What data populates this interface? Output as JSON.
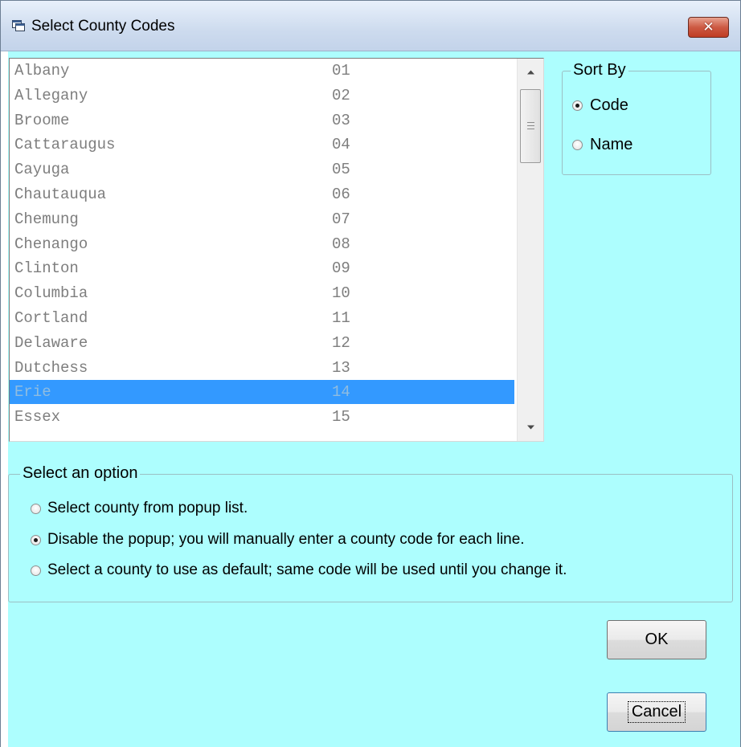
{
  "window": {
    "title": "Select County Codes",
    "close_glyph": "✕",
    "app_icon": "dialog-window-icon"
  },
  "colors": {
    "client_background": "#ADFEFE",
    "selection_highlight": "#3399FF",
    "title_bar": "#CDDBEE",
    "close_button": "#C9523B"
  },
  "county_list": {
    "selected_index": 13,
    "items": [
      {
        "name": "Albany",
        "code": "01"
      },
      {
        "name": "Allegany",
        "code": "02"
      },
      {
        "name": "Broome",
        "code": "03"
      },
      {
        "name": "Cattaraugus",
        "code": "04"
      },
      {
        "name": "Cayuga",
        "code": "05"
      },
      {
        "name": "Chautauqua",
        "code": "06"
      },
      {
        "name": "Chemung",
        "code": "07"
      },
      {
        "name": "Chenango",
        "code": "08"
      },
      {
        "name": "Clinton",
        "code": "09"
      },
      {
        "name": "Columbia",
        "code": "10"
      },
      {
        "name": "Cortland",
        "code": "11"
      },
      {
        "name": "Delaware",
        "code": "12"
      },
      {
        "name": "Dutchess",
        "code": "13"
      },
      {
        "name": "Erie",
        "code": "14"
      },
      {
        "name": "Essex",
        "code": "15"
      }
    ]
  },
  "sort_by": {
    "title": "Sort By",
    "options": [
      {
        "label": "Code",
        "checked": true
      },
      {
        "label": "Name",
        "checked": false
      }
    ]
  },
  "select_option": {
    "title": "Select an option",
    "options": [
      {
        "label": "Select county from popup list.",
        "checked": false
      },
      {
        "label": "Disable the popup; you will manually enter a county code for each line.",
        "checked": true
      },
      {
        "label": "Select a county to use as default; same code will be used until you change it.",
        "checked": false
      }
    ]
  },
  "buttons": {
    "ok_label": "OK",
    "cancel_label": "Cancel"
  }
}
